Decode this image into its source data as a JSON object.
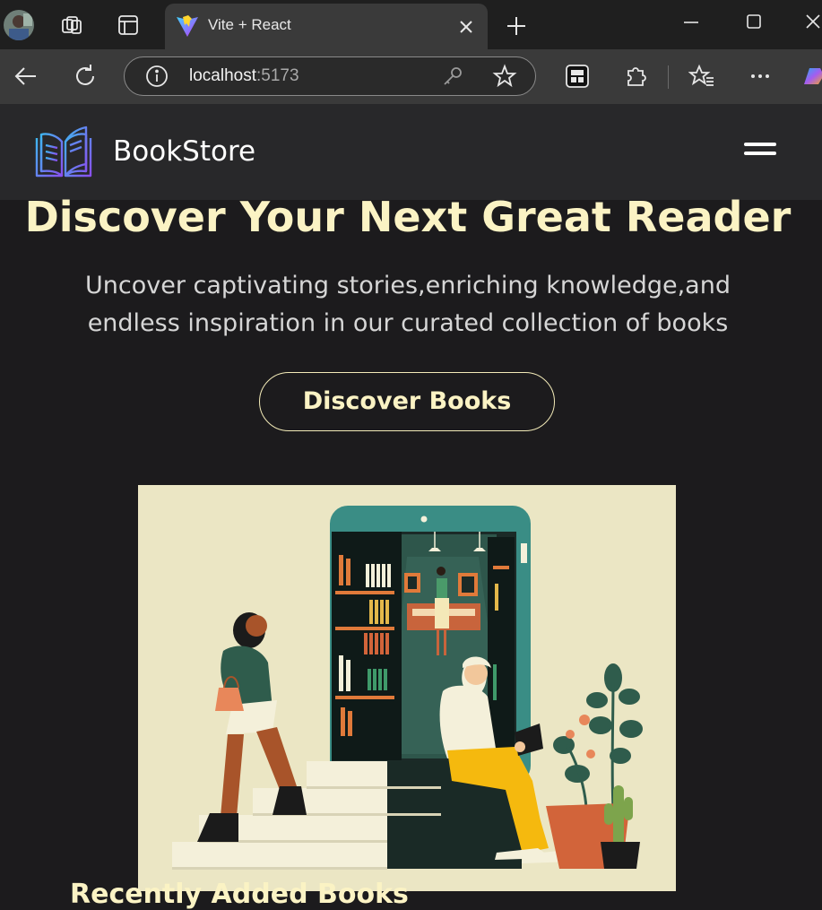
{
  "browser": {
    "tab_title": "Vite + React",
    "url_host": "localhost",
    "url_port": ":5173",
    "icons": [
      "profile-avatar",
      "workspaces-icon",
      "tab-actions-icon",
      "vite-logo-icon",
      "close-tab-icon",
      "new-tab-icon",
      "minimize-icon",
      "maximize-icon",
      "close-window-icon",
      "back-icon",
      "refresh-icon",
      "site-info-icon",
      "password-key-icon",
      "favorite-star-icon",
      "extension-icon",
      "puzzle-extensions-icon",
      "favorites-icon",
      "more-icon",
      "copilot-icon"
    ]
  },
  "nav": {
    "brand_name": "BookStore",
    "icons": [
      "open-book-logo-icon",
      "hamburger-menu-icon"
    ]
  },
  "hero": {
    "title": "Discover Your Next Great Reader",
    "subtitle": "Uncover captivating stories,enriching knowledge,and endless inspiration in our curated collection of books",
    "cta_label": "Discover Books",
    "next_heading": "Recently Added Books"
  },
  "colors": {
    "page_bg": "#1c1b1d",
    "nav_bg": "#28282a",
    "accent": "#fbf3c4",
    "illustration_bg": "#ebe6c4"
  }
}
